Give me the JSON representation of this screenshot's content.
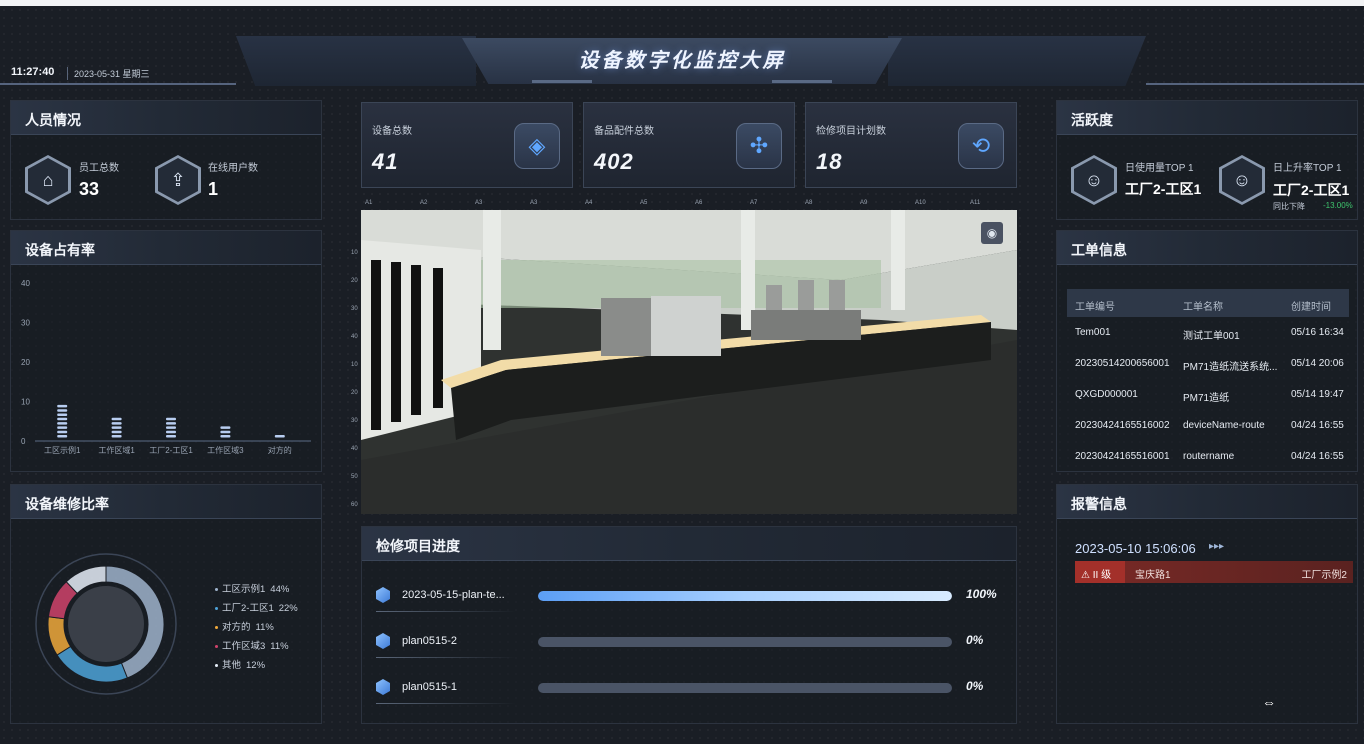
{
  "header": {
    "title": "设备数字化监控大屏",
    "time": "11:27:40",
    "date": "2023-05-31 星期三"
  },
  "personnel": {
    "title": "人员情况",
    "items": [
      {
        "label": "员工总数",
        "value": "33",
        "icon": "user-home-icon"
      },
      {
        "label": "在线用户数",
        "value": "1",
        "icon": "online-user-icon"
      }
    ]
  },
  "occupancy": {
    "title": "设备占有率",
    "chart_data": {
      "type": "bar",
      "categories": [
        "工区示例1",
        "工作区域1",
        "工厂2-工区1",
        "工作区域3",
        "对方的"
      ],
      "values": [
        9,
        6,
        6,
        4,
        2
      ],
      "yticks": [
        "40",
        "30",
        "20",
        "10",
        "0"
      ],
      "ylim": [
        0,
        40
      ]
    }
  },
  "repair_ratio": {
    "title": "设备维修比率",
    "chart_data": {
      "type": "pie",
      "slices": [
        {
          "label": "工区示例1",
          "pct": "44%",
          "value": 44,
          "color": "#9fb3cc"
        },
        {
          "label": "工厂2-工区1",
          "pct": "22%",
          "value": 22,
          "color": "#4ea3d8"
        },
        {
          "label": "对方的",
          "pct": "11%",
          "value": 11,
          "color": "#f0a93b"
        },
        {
          "label": "工作区域3",
          "pct": "11%",
          "value": 11,
          "color": "#d0436b"
        },
        {
          "label": "其他",
          "pct": "12%",
          "value": 12,
          "color": "#e6eef8"
        }
      ]
    }
  },
  "stats": [
    {
      "label": "设备总数",
      "value": "41",
      "icon": "cube-icon"
    },
    {
      "label": "备品配件总数",
      "value": "402",
      "icon": "parts-icon"
    },
    {
      "label": "检修项目计划数",
      "value": "18",
      "icon": "maintenance-icon"
    }
  ],
  "viewer": {
    "ruler_top": [
      "A1",
      "A2",
      "A3",
      "A3",
      "A4",
      "A5",
      "A6",
      "A7",
      "A8",
      "A9",
      "A10",
      "A11"
    ],
    "ruler_left": [
      "10",
      "20",
      "30",
      "40",
      "10",
      "20",
      "30",
      "40",
      "50",
      "60"
    ]
  },
  "progress": {
    "title": "检修项目进度",
    "items": [
      {
        "name": "2023-05-15-plan-te...",
        "pct_label": "100%",
        "pct": 100
      },
      {
        "name": "plan0515-2",
        "pct_label": "0%",
        "pct": 0
      },
      {
        "name": "plan0515-1",
        "pct_label": "0%",
        "pct": 0
      }
    ]
  },
  "activity": {
    "title": "活跃度",
    "items": [
      {
        "label": "日使用量TOP 1",
        "value": "工厂2-工区1",
        "icon": "users-icon"
      },
      {
        "label": "日上升率TOP 1",
        "value": "工厂2-工区1",
        "icon": "users-icon",
        "sub_label": "同比下降",
        "sub_value": "-13.00%"
      }
    ]
  },
  "work_orders": {
    "title": "工单信息",
    "columns": [
      "工单编号",
      "工单名称",
      "创建时间"
    ],
    "rows": [
      [
        "Tem001",
        "测试工单001",
        "05/16 16:34"
      ],
      [
        "20230514200656001",
        "PM71造纸流送系统...",
        "05/14 20:06"
      ],
      [
        "QXGD000001",
        "PM71造纸",
        "05/14 19:47"
      ],
      [
        "20230424165516002",
        "deviceName-route",
        "04/24 16:55"
      ],
      [
        "20230424165516001",
        "routername",
        "04/24 16:55"
      ]
    ]
  },
  "alarms": {
    "title": "报警信息",
    "time": "2023-05-10 15:06:06",
    "items": [
      {
        "level": "II 级",
        "location": "宝庆路1",
        "area": "工厂示例2"
      }
    ]
  },
  "colors": {
    "accent": "#5b9ef5",
    "alarm": "#a3302a",
    "panel_bg": "#1a1e25"
  }
}
